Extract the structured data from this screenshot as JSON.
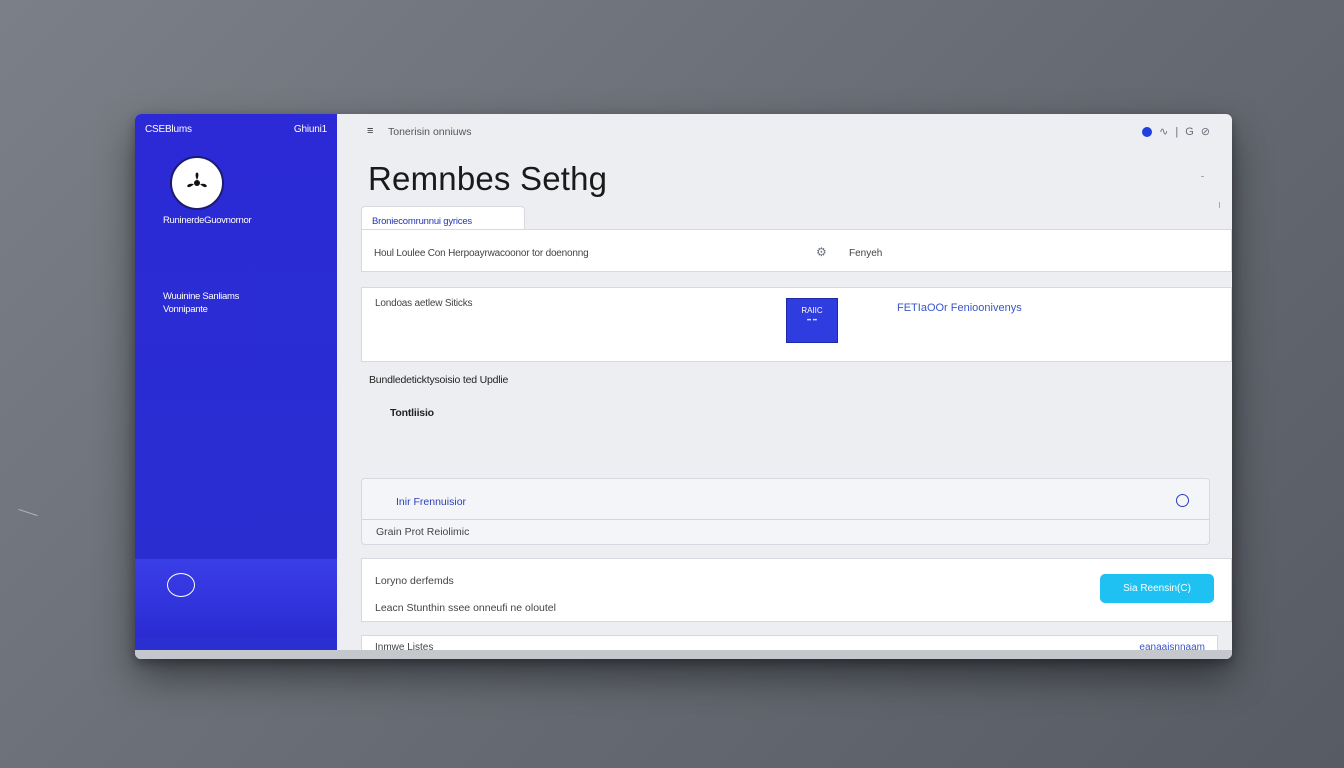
{
  "sidebar": {
    "top_left": "CSEBlums",
    "top_right": "Ghiuni1",
    "org_name": "RuninerdeGuovnornor",
    "text_line1": "Wuuinine Sanliams",
    "text_line2": "Vonnipante"
  },
  "topbar": {
    "menu_glyph": "≡",
    "title": "Tonerisin onniuws",
    "icons": [
      "status-dot",
      "chevron-icon",
      "help-icon",
      "user-icon"
    ]
  },
  "page": {
    "title": "Remnbes Sethg"
  },
  "tab": {
    "label": "Broniecomrunnui gyrices"
  },
  "row1": {
    "text": "Houl Loulee Con Herpoayrwacoonor tor doenonng",
    "value": "Fenyeh"
  },
  "card2": {
    "text": "Londoas aetlew Siticks",
    "box_line1": "RAIIC",
    "box_line2": "•• ••",
    "link": "FETIаOOr Fenioonivenys"
  },
  "section": {
    "label": "Bundledeticktysoisio ted Updlie",
    "sub": "Tontliisio"
  },
  "card3": {
    "line1": "Inir Frennuisior",
    "line2": "Grain Prot Reiolimic"
  },
  "card4": {
    "line1": "Loryno derfemds",
    "line2": "Leacn Stunthin ssee onneufi ne oloutel",
    "button": "Sia Reensin(C)"
  },
  "card5": {
    "left": "Inmwe Listes",
    "right": "eanaaisnnaam"
  },
  "colors": {
    "sidebar": "#2b2ad6",
    "accent_cyan": "#1ec1f2",
    "link_blue": "#3a56c8"
  }
}
